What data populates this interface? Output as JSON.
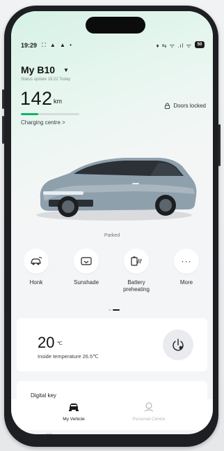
{
  "status_bar": {
    "time": "19:29",
    "left_icons": "⛶ ▲ ▲ •",
    "right_icons": "♦ ⇆ ᯤ .ıl ᯤ",
    "battery": "50"
  },
  "vehicle": {
    "name": "My B10",
    "status_update": "Status update 19:22 Today",
    "range_value": "142",
    "range_unit": "km",
    "range_fraction": 0.3,
    "charging_link": "Charging centre  >",
    "doors_status": "Doors locked",
    "parked_label": "Parked"
  },
  "controls": [
    {
      "icon": "car-horn-icon",
      "label": "Honk"
    },
    {
      "icon": "sunshade-icon",
      "label": "Sunshade"
    },
    {
      "icon": "battery-preheat-icon",
      "label": "Battery preheating"
    },
    {
      "icon": "more-icon",
      "label": "More"
    }
  ],
  "climate": {
    "temperature": "20",
    "unit": "℃",
    "inside_temperature": "Inside temperature 26.5℃"
  },
  "digital_key": {
    "title": "Digital key"
  },
  "tabs": [
    {
      "label": "My Vehicle",
      "active": true
    },
    {
      "label": "Personal Centre",
      "active": false
    }
  ],
  "colors": {
    "accent": "#12b36a",
    "background": "#f4f5f7",
    "card": "#ffffff"
  }
}
